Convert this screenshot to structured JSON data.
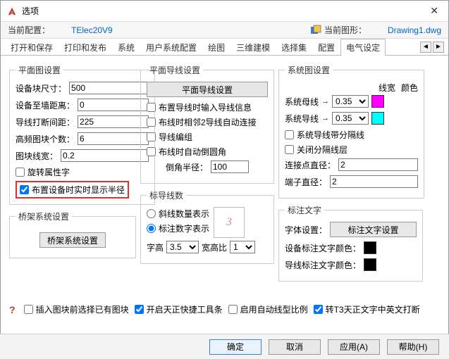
{
  "window": {
    "title": "选项"
  },
  "header": {
    "profile_label": "当前配置：",
    "profile_value": "TElec20V9",
    "drawing_label": "当前图形：",
    "drawing_value": "Drawing1.dwg"
  },
  "tabs": {
    "items": [
      "打开和保存",
      "打印和发布",
      "系统",
      "用户系统配置",
      "绘图",
      "三维建模",
      "选择集",
      "配置",
      "电气设定"
    ],
    "active_index": 8
  },
  "plane_settings": {
    "legend": "平面图设置",
    "block_size_label": "设备块尺寸：",
    "block_size": "500",
    "to_wall_label": "设备至墙距离：",
    "to_wall": "0",
    "break_label": "导线打断间距：",
    "break": "225",
    "hf_count_label": "高频图块个数：",
    "hf_count": "6",
    "line_w_label": "图块线宽：",
    "line_w": "0.2",
    "rotate_label": "旋转属性字",
    "realtime_radius_label": "布置设备时实时显示半径"
  },
  "bridge": {
    "legend": "桥架系统设置",
    "btn": "桥架系统设置"
  },
  "wire_settings": {
    "legend": "平面导线设置",
    "btn": "平面导线设置",
    "input_info": "布置导线时输入导线信息",
    "adjacent_auto": "布线时相邻2导线自动连接",
    "wire_edit": "导线编组",
    "auto_fillet": "布线时自动倒圆角",
    "fillet_r_label": "倒角半径：",
    "fillet_r": "100"
  },
  "callout": {
    "legend": "标导线数",
    "slant": "斜线数量表示",
    "digit": "标注数字表示",
    "preview": "3",
    "font_h_label": "字高",
    "font_h": "3.5",
    "ratio_label": "宽高比",
    "ratio": "1"
  },
  "sys_settings": {
    "legend": "系统图设置",
    "col_lw": "线宽",
    "col_color": "颜色",
    "busbar_label": "系统母线",
    "busbar_lw": "0.35",
    "wire_label": "系统导线",
    "wire_lw": "0.35",
    "sep_line": "系统导线带分隔线",
    "close_sep": "关闭分隔线层",
    "conn_d_label": "连接点直径：",
    "conn_d": "2",
    "term_d_label": "端子直径：",
    "term_d": "2",
    "color_busbar": "#ff00ff",
    "color_wire": "#00ffff"
  },
  "text_settings": {
    "legend": "标注文字",
    "font_set_label": "字体设置：",
    "font_set_btn": "标注文字设置",
    "dev_color_label": "设备标注文字颜色：",
    "wire_color_label": "导线标注文字颜色：",
    "color_dev": "#000000",
    "color_wire": "#000000"
  },
  "bottom": {
    "pre_select": "插入图块前选择已有图块",
    "enable_toolbar": "开启天正快捷工具条",
    "auto_ltype": "启用自动线型比例",
    "t3_punct": "转T3天正文字中英文打断"
  },
  "footer": {
    "ok": "确定",
    "cancel": "取消",
    "apply": "应用(A)",
    "help": "帮助(H)"
  }
}
